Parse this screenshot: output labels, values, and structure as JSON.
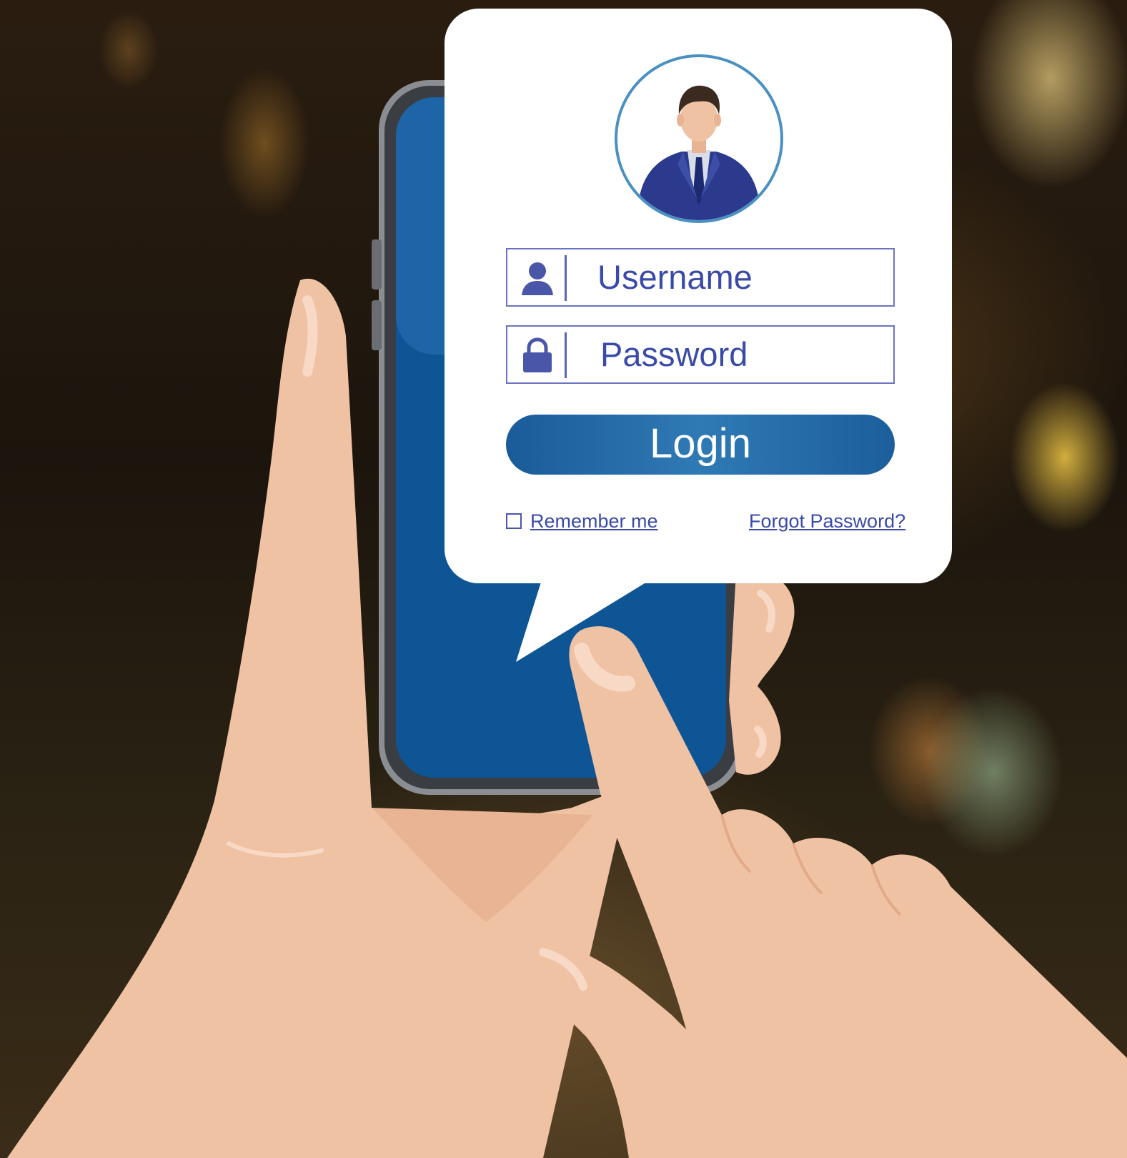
{
  "login_form": {
    "username_placeholder": "Username",
    "password_placeholder": "Password",
    "login_label": "Login",
    "remember_label": "Remember me",
    "remember_checked": false,
    "forgot_label": "Forgot Password?"
  },
  "icons": {
    "avatar": "user-avatar-icon",
    "username": "user-icon",
    "password": "lock-icon"
  },
  "colors": {
    "accent_blue": "#1d5f9c",
    "field_border": "#6b74c2",
    "text_blue": "#3a4aa8",
    "card_bg": "#ffffff",
    "skin": "#f0c2a4"
  }
}
